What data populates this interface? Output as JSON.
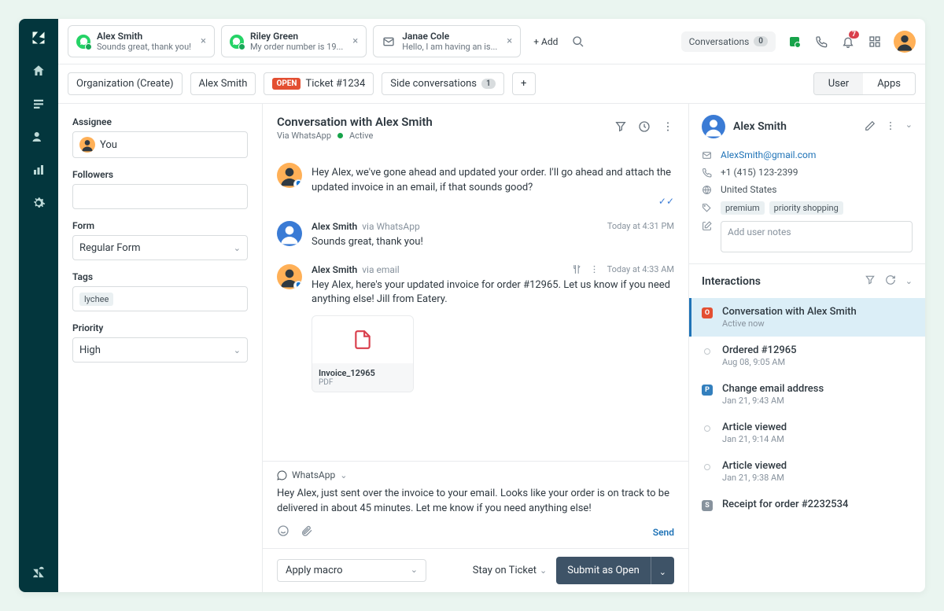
{
  "tabs": [
    {
      "icon": "whatsapp",
      "title": "Alex Smith",
      "subtitle": "Sounds great, thank you!"
    },
    {
      "icon": "whatsapp",
      "title": "Riley Green",
      "subtitle": "My order number is 19..."
    },
    {
      "icon": "mail",
      "title": "Janae Cole",
      "subtitle": "Hello, I am having an is..."
    }
  ],
  "addTab": "+ Add",
  "header": {
    "conversations": "Conversations",
    "conversationsCount": "0",
    "notifCount": "7"
  },
  "subnav": {
    "org": "Organization (Create)",
    "requester": "Alex Smith",
    "openBadge": "OPEN",
    "ticket": "Ticket #1234",
    "side": "Side conversations",
    "sideCount": "1",
    "user": "User",
    "apps": "Apps"
  },
  "form": {
    "assigneeLabel": "Assignee",
    "assigneeValue": "You",
    "followersLabel": "Followers",
    "formLabel": "Form",
    "formValue": "Regular Form",
    "tagsLabel": "Tags",
    "tagValue": "lychee",
    "priorityLabel": "Priority",
    "priorityValue": "High"
  },
  "convo": {
    "title": "Conversation with Alex Smith",
    "via": "Via WhatsApp",
    "status": "Active",
    "messages": [
      {
        "author": "",
        "via": "",
        "time": "",
        "text": "Hey Alex, we've gone ahead and updated your order. I'll go ahead and attach the updated invoice in an email, if that sounds good?",
        "avatar": "agent"
      },
      {
        "author": "Alex Smith",
        "via": "via WhatsApp",
        "time": "Today at 4:31 PM",
        "text": "Sounds great, thank you!",
        "avatar": "user"
      },
      {
        "author": "Alex Smith",
        "via": "via email",
        "time": "Today at 4:33 AM",
        "text": "Hey Alex, here's your updated invoice for order #12965. Let us know if you need anything else! Jill from Eatery.",
        "avatar": "agent",
        "attachment": {
          "name": "Invoice_12965",
          "type": "PDF"
        }
      }
    ],
    "composeChannel": "WhatsApp",
    "composeText": "Hey Alex, just sent over the invoice to your email. Looks like your order is on track to be delivered in about 45 minutes. Let me know if you need anything else!",
    "send": "Send",
    "macro": "Apply macro",
    "stay": "Stay on Ticket",
    "submit": "Submit as Open"
  },
  "user": {
    "name": "Alex Smith",
    "email": "AlexSmith@gmail.com",
    "phone": "+1 (415) 123-2399",
    "location": "United States",
    "tags": [
      "premium",
      "priority shopping"
    ],
    "notesPlaceholder": "Add user notes",
    "interactionsLabel": "Interactions",
    "interactions": [
      {
        "kind": "O",
        "color": "#e34f32",
        "title": "Conversation with Alex Smith",
        "time": "Active now",
        "active": true
      },
      {
        "kind": "dot",
        "title": "Ordered #12965",
        "time": "Aug 08, 9:05 AM"
      },
      {
        "kind": "P",
        "color": "#337fbd",
        "title": "Change email address",
        "time": "Jan 21, 9:43 AM"
      },
      {
        "kind": "dot",
        "title": "Article viewed",
        "time": "Jan 21, 9:14 AM"
      },
      {
        "kind": "dot",
        "title": "Article viewed",
        "time": "Jan 21, 9:38 AM"
      },
      {
        "kind": "S",
        "color": "#87929d",
        "title": "Receipt for order #2232534",
        "time": ""
      }
    ]
  }
}
